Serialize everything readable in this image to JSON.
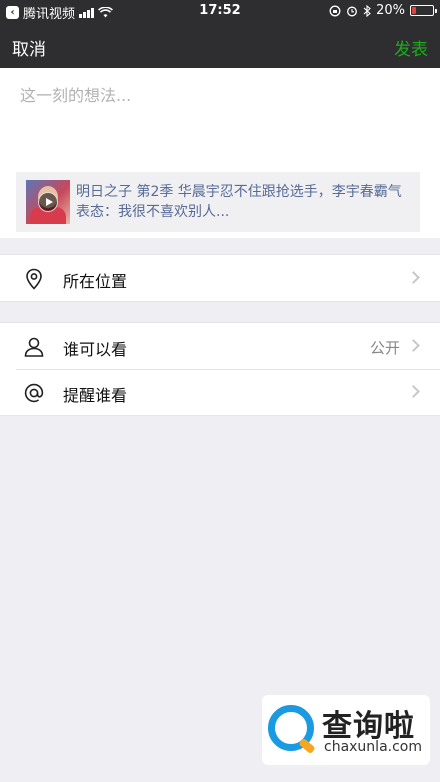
{
  "status_bar": {
    "carrier": "腾讯视频",
    "time": "17:52",
    "battery_level": 0.2,
    "battery_percent": "20%",
    "icons": [
      "back-to-app-icon",
      "signal-icon",
      "wifi-icon",
      "rotation-lock-icon",
      "alarm-icon",
      "bluetooth-icon",
      "battery-icon"
    ]
  },
  "nav": {
    "cancel_label": "取消",
    "publish_label": "发表"
  },
  "compose": {
    "placeholder": "这一刻的想法..."
  },
  "share_card": {
    "title": "明日之子 第2季 华晨宇忍不住跟抢选手，李宇春霸气表态：我很不喜欢别人..."
  },
  "options": {
    "location": {
      "label": "所在位置",
      "icon": "location-pin-icon"
    },
    "visibility": {
      "label": "谁可以看",
      "value": "公开",
      "icon": "person-icon"
    },
    "mention": {
      "label": "提醒谁看",
      "icon": "at-icon"
    }
  },
  "watermark": {
    "brand": "查询啦",
    "domain": "chaxunla.com"
  },
  "colors": {
    "bar_bg": "#2e2e31",
    "publish_green": "#1aad19",
    "link_blue": "#576b95",
    "page_bg": "#eeeef3",
    "battery_red": "#e8413b"
  }
}
